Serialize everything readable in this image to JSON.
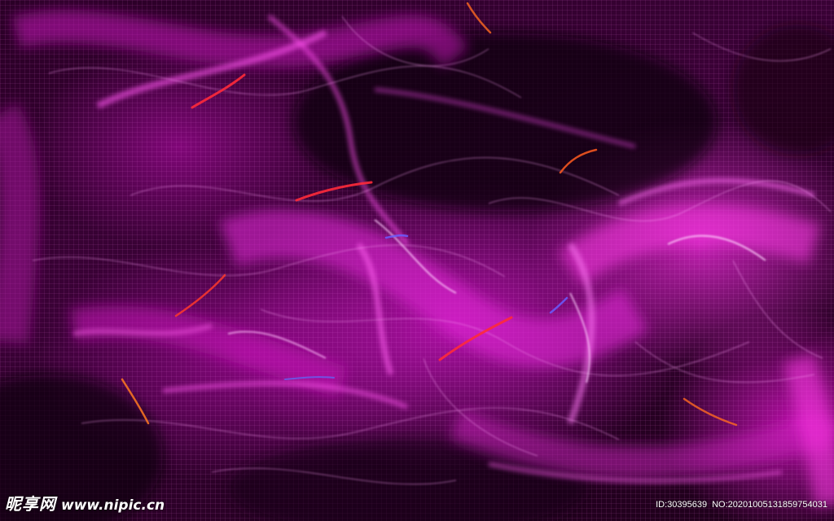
{
  "image": {
    "description_colors": {
      "background": "#2a0026",
      "primary_glow": "#e01fd0",
      "accent_red": "#ff2a3a",
      "accent_blue": "#6a5cff"
    }
  },
  "watermark": {
    "brand": "昵享网",
    "url": "www.nipic.cn",
    "id_text": "ID:30395639",
    "no_text": "NO:20201005131859754031"
  }
}
